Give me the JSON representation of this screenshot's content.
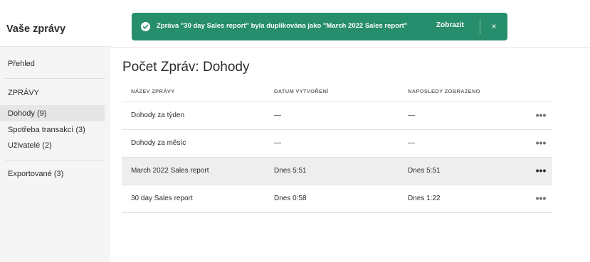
{
  "sidebar": {
    "title": "Vaše zprávy",
    "overview": "Přehled",
    "section_heading": "ZPRÁVY",
    "items": [
      {
        "label": "Dohody (9)"
      },
      {
        "label": "Spotřeba transakcí (3)"
      },
      {
        "label": "Uživatelé (2)"
      }
    ],
    "exported": "Exportované (3)"
  },
  "main": {
    "title": "Počet Zpráv: Dohody",
    "columns": [
      "NÁZEV ZPRÁVY",
      "DATUM VYTVOŘENÍ",
      "NAPOSLEDY ZOBRAZENO"
    ],
    "rows": [
      {
        "name": "Dohody za týden",
        "created": "—",
        "viewed": "—",
        "more": "•••"
      },
      {
        "name": "Dohody za měsíc",
        "created": "—",
        "viewed": "—",
        "more": "•••"
      },
      {
        "name": "March 2022 Sales report",
        "created": "Dnes 5:51",
        "viewed": "Dnes 5:51",
        "more": "•••"
      },
      {
        "name": "30 day Sales report",
        "created": "Dnes 0:58",
        "viewed": "Dnes 1:22",
        "more": "•••"
      }
    ]
  },
  "toast": {
    "message": "Zpráva \"30 day Sales report\" byla duplikována jako \"March 2022 Sales report\"",
    "action": "Zobrazit",
    "close": "×",
    "icon": "checkmark-circle-icon",
    "color": "#268e6c"
  }
}
